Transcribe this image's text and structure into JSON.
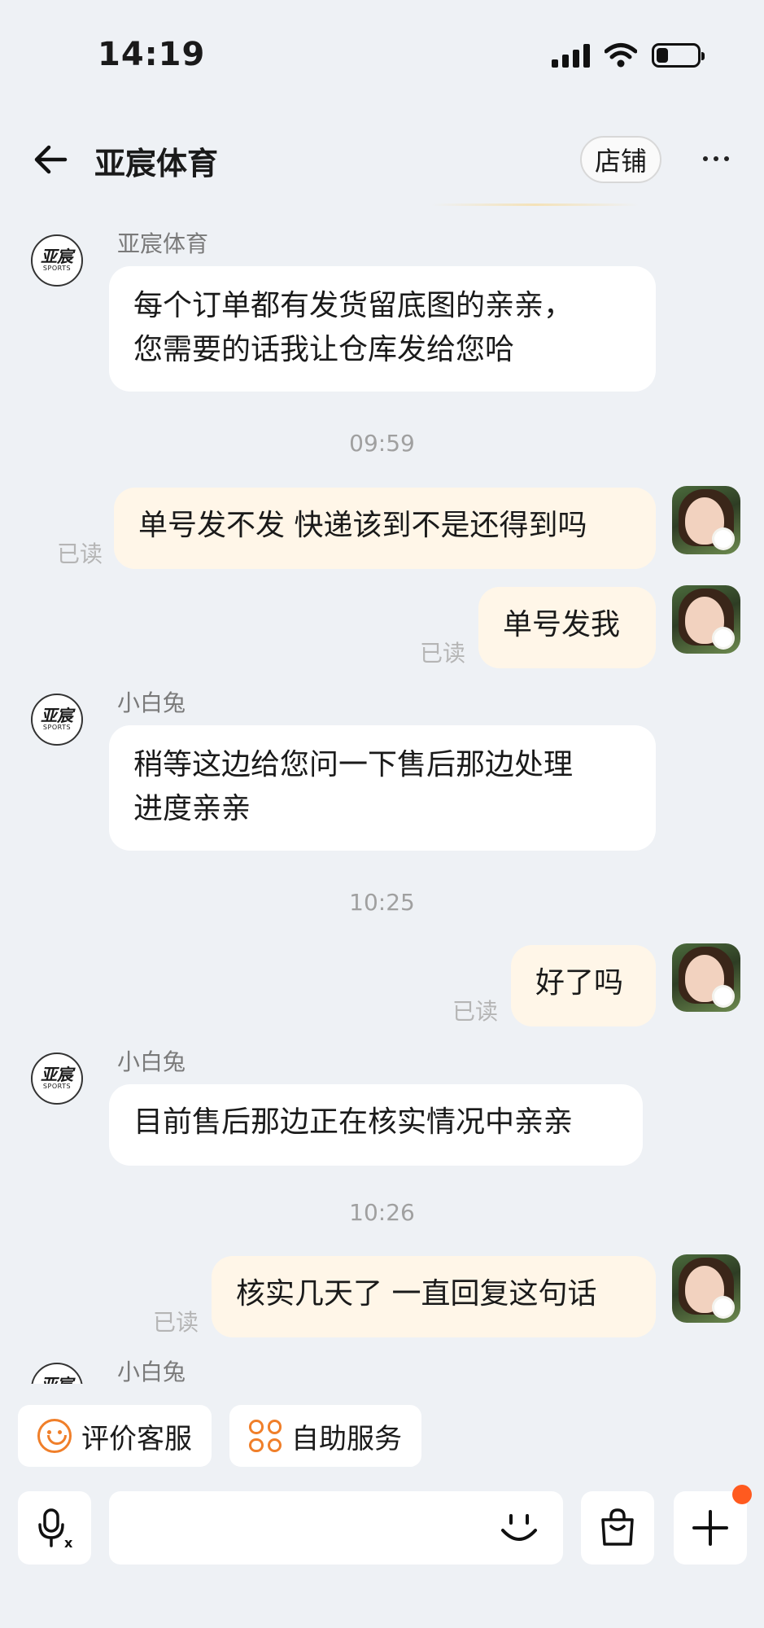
{
  "status_bar": {
    "time": "14:19",
    "battery_level": 0.3
  },
  "header": {
    "title": "亚宸体育",
    "store_label": "店铺"
  },
  "shop_logo": {
    "main": "亚宸",
    "sub": "SPORTS"
  },
  "messages": [
    {
      "sender": "亚宸体育",
      "lines": [
        "每个订单都有发货留底图的亲亲，",
        "您需要的话我让仓库发给您哈"
      ]
    },
    {
      "time": "09:59"
    },
    {
      "text": "单号发不发 快递该到不是还得到吗",
      "read": "已读"
    },
    {
      "text": "单号发我",
      "read": "已读"
    },
    {
      "sender": "小白兔",
      "lines": [
        "稍等这边给您问一下售后那边处理",
        "进度亲亲"
      ]
    },
    {
      "time": "10:25"
    },
    {
      "text": "好了吗",
      "read": "已读"
    },
    {
      "sender": "小白兔",
      "lines": [
        "目前售后那边正在核实情况中亲亲"
      ]
    },
    {
      "time": "10:26"
    },
    {
      "text": "核实几天了 一直回复这句话",
      "read": "已读"
    },
    {
      "sender": "小白兔"
    }
  ],
  "quick_actions": {
    "rate": "评价客服",
    "self_service": "自助服务"
  },
  "input": {
    "placeholder": ""
  },
  "icons": {
    "back": "arrow-left-icon",
    "more": "more-dots-icon",
    "voice": "microphone-icon",
    "emoji": "smile-icon",
    "bag": "shopping-bag-icon",
    "plus": "plus-icon",
    "rate": "smile-face-icon",
    "self_service": "grid-circles-icon"
  },
  "colors": {
    "accent": "#f07f2a",
    "badge": "#ff5a1f",
    "outgoing_bubble": "#fff6e8",
    "background": "#eef1f5"
  }
}
